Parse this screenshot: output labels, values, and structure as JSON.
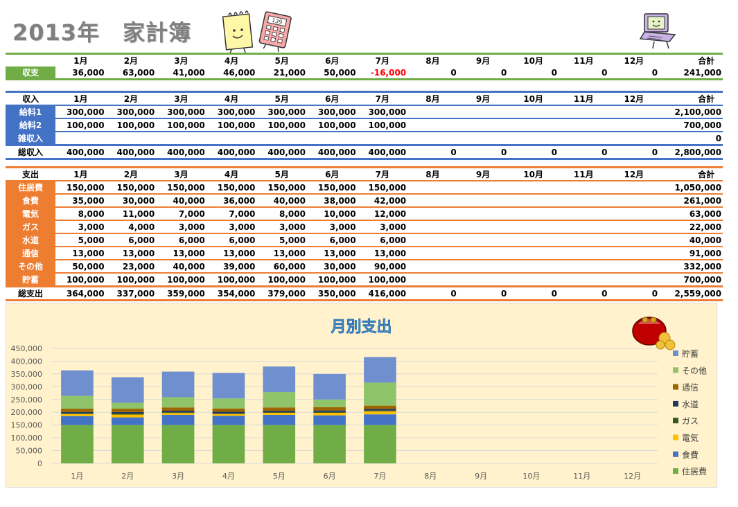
{
  "title": "2013年　家計簿",
  "months": [
    "1月",
    "2月",
    "3月",
    "4月",
    "5月",
    "6月",
    "7月",
    "8月",
    "9月",
    "10月",
    "11月",
    "12月"
  ],
  "total_header": "合計",
  "summary": {
    "label": "収支",
    "values": [
      "36,000",
      "63,000",
      "41,000",
      "46,000",
      "21,000",
      "50,000",
      "-16,000",
      "0",
      "0",
      "0",
      "0",
      "0"
    ],
    "total": "241,000",
    "negative_color": "#ff0000"
  },
  "income": {
    "header_label": "収入",
    "rows": [
      {
        "label": "給料1",
        "values": [
          "300,000",
          "300,000",
          "300,000",
          "300,000",
          "300,000",
          "300,000",
          "300,000",
          "",
          "",
          "",
          "",
          ""
        ],
        "total": "2,100,000"
      },
      {
        "label": "給料2",
        "values": [
          "100,000",
          "100,000",
          "100,000",
          "100,000",
          "100,000",
          "100,000",
          "100,000",
          "",
          "",
          "",
          "",
          ""
        ],
        "total": "700,000"
      },
      {
        "label": "雑収入",
        "values": [
          "",
          "",
          "",
          "",
          "",
          "",
          "",
          "",
          "",
          "",
          "",
          ""
        ],
        "total": "0"
      }
    ],
    "total_row": {
      "label": "総収入",
      "values": [
        "400,000",
        "400,000",
        "400,000",
        "400,000",
        "400,000",
        "400,000",
        "400,000",
        "0",
        "0",
        "0",
        "0",
        "0"
      ],
      "total": "2,800,000"
    }
  },
  "expense": {
    "header_label": "支出",
    "rows": [
      {
        "label": "住居費",
        "values": [
          "150,000",
          "150,000",
          "150,000",
          "150,000",
          "150,000",
          "150,000",
          "150,000",
          "",
          "",
          "",
          "",
          ""
        ],
        "total": "1,050,000"
      },
      {
        "label": "食費",
        "values": [
          "35,000",
          "30,000",
          "40,000",
          "36,000",
          "40,000",
          "38,000",
          "42,000",
          "",
          "",
          "",
          "",
          ""
        ],
        "total": "261,000"
      },
      {
        "label": "電気",
        "values": [
          "8,000",
          "11,000",
          "7,000",
          "7,000",
          "8,000",
          "10,000",
          "12,000",
          "",
          "",
          "",
          "",
          ""
        ],
        "total": "63,000"
      },
      {
        "label": "ガス",
        "values": [
          "3,000",
          "4,000",
          "3,000",
          "3,000",
          "3,000",
          "3,000",
          "3,000",
          "",
          "",
          "",
          "",
          ""
        ],
        "total": "22,000"
      },
      {
        "label": "水道",
        "values": [
          "5,000",
          "6,000",
          "6,000",
          "6,000",
          "5,000",
          "6,000",
          "6,000",
          "",
          "",
          "",
          "",
          ""
        ],
        "total": "40,000"
      },
      {
        "label": "通信",
        "values": [
          "13,000",
          "13,000",
          "13,000",
          "13,000",
          "13,000",
          "13,000",
          "13,000",
          "",
          "",
          "",
          "",
          ""
        ],
        "total": "91,000"
      },
      {
        "label": "その他",
        "values": [
          "50,000",
          "23,000",
          "40,000",
          "39,000",
          "60,000",
          "30,000",
          "90,000",
          "",
          "",
          "",
          "",
          ""
        ],
        "total": "332,000"
      },
      {
        "label": "貯蓄",
        "values": [
          "100,000",
          "100,000",
          "100,000",
          "100,000",
          "100,000",
          "100,000",
          "100,000",
          "",
          "",
          "",
          "",
          ""
        ],
        "total": "700,000"
      }
    ],
    "total_row": {
      "label": "総支出",
      "values": [
        "364,000",
        "337,000",
        "359,000",
        "354,000",
        "379,000",
        "350,000",
        "416,000",
        "0",
        "0",
        "0",
        "0",
        "0"
      ],
      "total": "2,559,000"
    }
  },
  "colors": {
    "summary": "#70ad47",
    "income": "#4472c4",
    "expense": "#ed7d31",
    "chart_bg": "#fff2cc"
  },
  "icons": [
    "notepad-icon",
    "calculator-icon",
    "laptop-icon",
    "coin-purse-icon"
  ],
  "chart_data": {
    "type": "bar",
    "stacked": true,
    "title": "月別支出",
    "categories": [
      "1月",
      "2月",
      "3月",
      "4月",
      "5月",
      "6月",
      "7月",
      "8月",
      "9月",
      "10月",
      "11月",
      "12月"
    ],
    "ylim": [
      0,
      450000
    ],
    "yticks": [
      "0",
      "50,000",
      "100,000",
      "150,000",
      "200,000",
      "250,000",
      "300,000",
      "350,000",
      "400,000",
      "450,000"
    ],
    "grid": true,
    "legend": "right",
    "series": [
      {
        "name": "住居費",
        "color": "#70ad47",
        "values": [
          150000,
          150000,
          150000,
          150000,
          150000,
          150000,
          150000,
          0,
          0,
          0,
          0,
          0
        ]
      },
      {
        "name": "食費",
        "color": "#4472c4",
        "values": [
          35000,
          30000,
          40000,
          36000,
          40000,
          38000,
          42000,
          0,
          0,
          0,
          0,
          0
        ]
      },
      {
        "name": "電気",
        "color": "#ffc000",
        "values": [
          8000,
          11000,
          7000,
          7000,
          8000,
          10000,
          12000,
          0,
          0,
          0,
          0,
          0
        ]
      },
      {
        "name": "ガス",
        "color": "#375623",
        "values": [
          3000,
          4000,
          3000,
          3000,
          3000,
          3000,
          3000,
          0,
          0,
          0,
          0,
          0
        ]
      },
      {
        "name": "水道",
        "color": "#1f3864",
        "values": [
          5000,
          6000,
          6000,
          6000,
          5000,
          6000,
          6000,
          0,
          0,
          0,
          0,
          0
        ]
      },
      {
        "name": "通信",
        "color": "#9c6500",
        "values": [
          13000,
          13000,
          13000,
          13000,
          13000,
          13000,
          13000,
          0,
          0,
          0,
          0,
          0
        ]
      },
      {
        "name": "その他",
        "color": "#8fc46a",
        "values": [
          50000,
          23000,
          40000,
          39000,
          60000,
          30000,
          90000,
          0,
          0,
          0,
          0,
          0
        ]
      },
      {
        "name": "貯蓄",
        "color": "#6f8fcf",
        "values": [
          100000,
          100000,
          100000,
          100000,
          100000,
          100000,
          100000,
          0,
          0,
          0,
          0,
          0
        ]
      }
    ]
  }
}
